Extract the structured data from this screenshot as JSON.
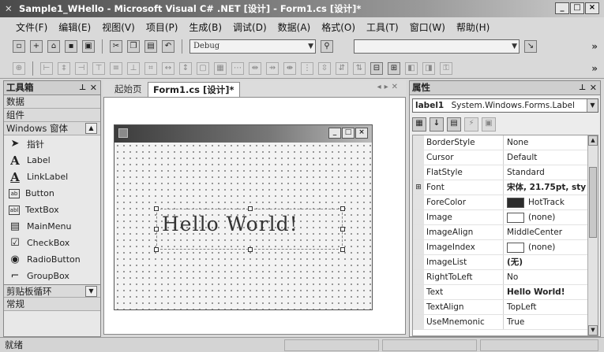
{
  "window": {
    "title": "Sample1_WHello - Microsoft Visual C# .NET [设计] - Form1.cs [设计]*",
    "controls": [
      "_",
      "□",
      "×"
    ]
  },
  "menu": [
    "文件(F)",
    "编辑(E)",
    "视图(V)",
    "项目(P)",
    "生成(B)",
    "调试(D)",
    "数据(A)",
    "格式(O)",
    "工具(T)",
    "窗口(W)",
    "帮助(H)"
  ],
  "toolbar": {
    "config": "Debug"
  },
  "toolbox": {
    "title": "工具箱",
    "categories_top": [
      "数据",
      "组件",
      "Windows 窗体"
    ],
    "items": [
      {
        "label": "指针",
        "icon": "pointer-icon"
      },
      {
        "label": "Label",
        "icon": "label-icon"
      },
      {
        "label": "LinkLabel",
        "icon": "linklabel-icon"
      },
      {
        "label": "Button",
        "icon": "button-icon"
      },
      {
        "label": "TextBox",
        "icon": "textbox-icon"
      },
      {
        "label": "MainMenu",
        "icon": "mainmenu-icon"
      },
      {
        "label": "CheckBox",
        "icon": "checkbox-icon"
      },
      {
        "label": "RadioButton",
        "icon": "radiobutton-icon"
      },
      {
        "label": "GroupBox",
        "icon": "groupbox-icon"
      }
    ],
    "categories_bottom": [
      "剪贴板循环",
      "常规"
    ]
  },
  "tabs": [
    {
      "label": "起始页",
      "active": false
    },
    {
      "label": "Form1.cs [设计]*",
      "active": true
    }
  ],
  "designer": {
    "label_text": "Hello World!"
  },
  "properties": {
    "title": "属性",
    "object_name": "label1",
    "object_type": "System.Windows.Forms.Label",
    "rows": [
      {
        "name": "BorderStyle",
        "value": "None"
      },
      {
        "name": "Cursor",
        "value": "Default"
      },
      {
        "name": "FlatStyle",
        "value": "Standard"
      },
      {
        "name": "Font",
        "value": "宋体, 21.75pt, sty",
        "expandable": true,
        "bold": true
      },
      {
        "name": "ForeColor",
        "value": "HotTrack",
        "swatch": "#2b2b2b"
      },
      {
        "name": "Image",
        "value": "(none)",
        "swatch": "#ffffff"
      },
      {
        "name": "ImageAlign",
        "value": "MiddleCenter"
      },
      {
        "name": "ImageIndex",
        "value": "(none)",
        "swatch": "#ffffff"
      },
      {
        "name": "ImageList",
        "value": "(无)",
        "bold": true
      },
      {
        "name": "RightToLeft",
        "value": "No"
      },
      {
        "name": "Text",
        "value": "Hello World!",
        "bold": true
      },
      {
        "name": "TextAlign",
        "value": "TopLeft"
      },
      {
        "name": "UseMnemonic",
        "value": "True"
      }
    ]
  },
  "status": {
    "text": "就绪"
  }
}
